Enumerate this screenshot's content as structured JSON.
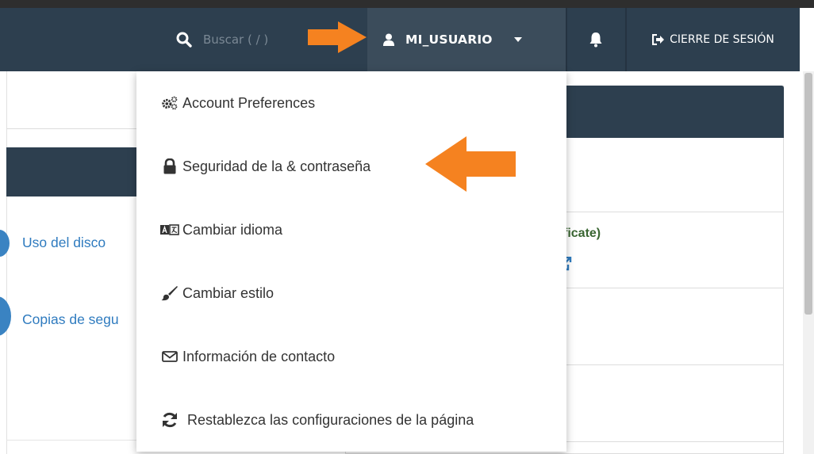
{
  "header": {
    "search_label": "Buscar ( / )",
    "username": "MI_USUARIO",
    "logout_label": "CIERRE DE SESIÓN"
  },
  "user_menu": {
    "items": [
      {
        "label": "Account Preferences",
        "icon": "gears-icon"
      },
      {
        "label": "Seguridad de la & contraseña",
        "icon": "lock-icon"
      },
      {
        "label": "Cambiar idioma",
        "icon": "language-icon"
      },
      {
        "label": "Cambiar estilo",
        "icon": "paintbrush-icon"
      },
      {
        "label": "Información de contacto",
        "icon": "envelope-icon"
      },
      {
        "label": "Restablezca las configuraciones de la página",
        "icon": "refresh-icon"
      }
    ]
  },
  "background": {
    "left_links": [
      "Uso del disco",
      "Copias de segu"
    ],
    "right_text": "rtificate)"
  },
  "colors": {
    "header_bg": "#2d3f4f",
    "user_menu_bg": "#3b4c5b",
    "link_blue": "#2f7bbf",
    "arrow_orange": "#f58220",
    "cert_green": "#3a6632"
  }
}
